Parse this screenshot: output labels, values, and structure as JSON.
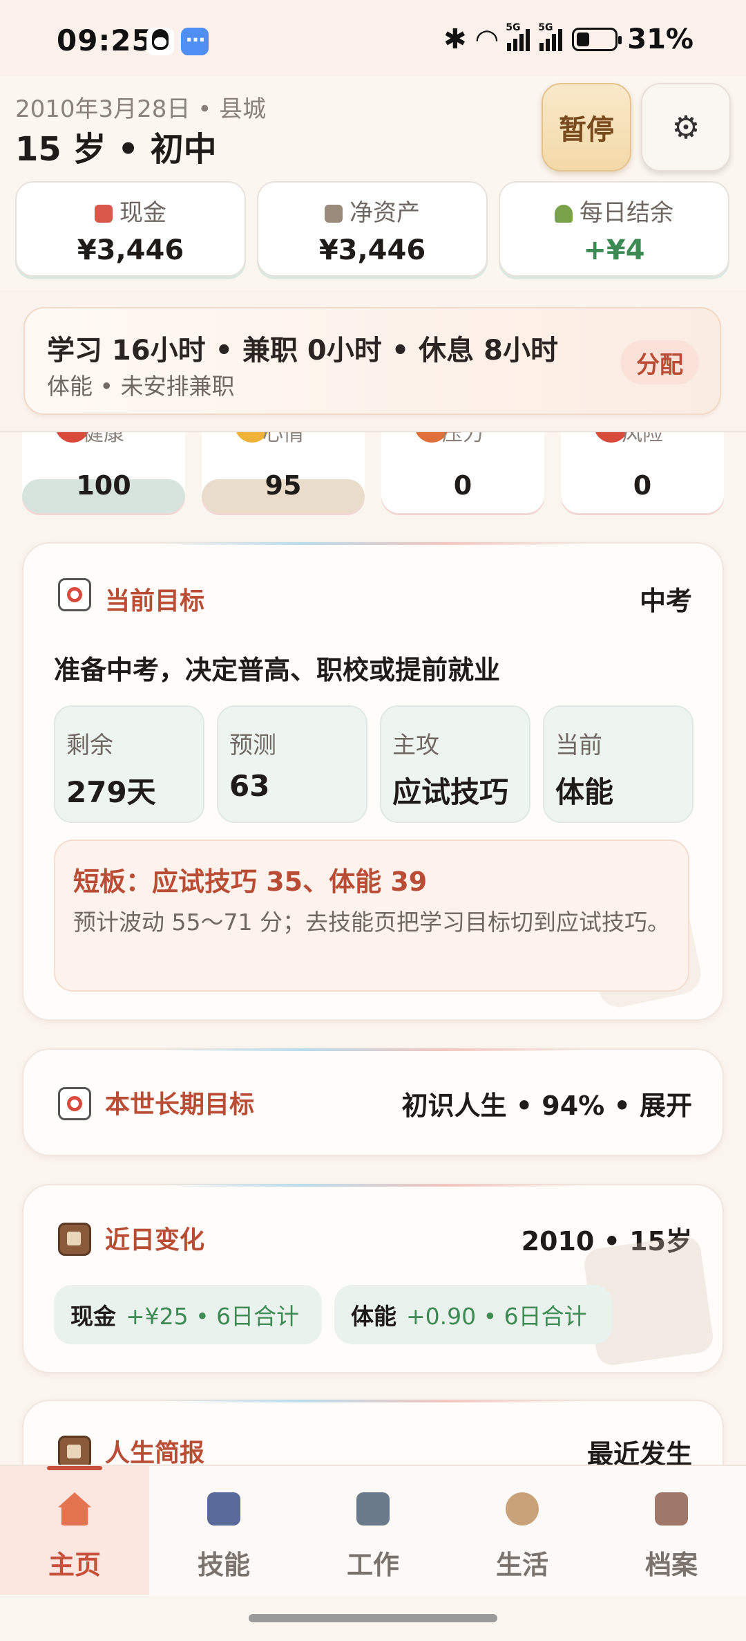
{
  "status_bar": {
    "time": "09:25",
    "battery": "31%",
    "network": "5G"
  },
  "header": {
    "date_place": "2010年3月28日 • 县城",
    "age_stage": "15 岁 • 初中",
    "pause_label": "暂停",
    "settings_icon": "⚙"
  },
  "stats": [
    {
      "label": "现金",
      "value": "¥3,446",
      "icon": "cash-icon"
    },
    {
      "label": "净资产",
      "value": "¥3,446",
      "icon": "building-icon"
    },
    {
      "label": "每日结余",
      "value": "+¥4",
      "icon": "sprout-icon"
    }
  ],
  "schedule": {
    "main": "学习 16小时 • 兼职 0小时 • 休息 8小时",
    "sub": "体能 • 未安排兼职",
    "allocate_label": "分配"
  },
  "attributes": [
    {
      "label": "健康",
      "value": "100"
    },
    {
      "label": "心情",
      "value": "95"
    },
    {
      "label": "压力",
      "value": "0"
    },
    {
      "label": "风险",
      "value": "0"
    }
  ],
  "goal": {
    "title": "当前目标",
    "tag": "中考",
    "description": "准备中考，决定普高、职校或提前就业",
    "items": [
      {
        "label": "剩余",
        "value": "279天"
      },
      {
        "label": "预测",
        "value": "63"
      },
      {
        "label": "主攻",
        "value": "应试技巧"
      },
      {
        "label": "当前",
        "value": "体能"
      }
    ],
    "weakness_title": "短板：应试技巧 35、体能 39",
    "weakness_note": "预计波动 55～71 分；去技能页把学习目标切到应试技巧。"
  },
  "long_term": {
    "title": "本世长期目标",
    "summary": "初识人生 • 94% • 展开"
  },
  "recent": {
    "title": "近日变化",
    "tag": "2010 • 15岁",
    "chips": [
      {
        "name": "现金",
        "delta": "+¥25 • 6日合计"
      },
      {
        "name": "体能",
        "delta": "+0.90 • 6日合计"
      }
    ]
  },
  "brief": {
    "title": "人生简报",
    "tag": "最近发生"
  },
  "nav": [
    {
      "label": "主页"
    },
    {
      "label": "技能"
    },
    {
      "label": "工作"
    },
    {
      "label": "生活"
    },
    {
      "label": "档案"
    }
  ]
}
